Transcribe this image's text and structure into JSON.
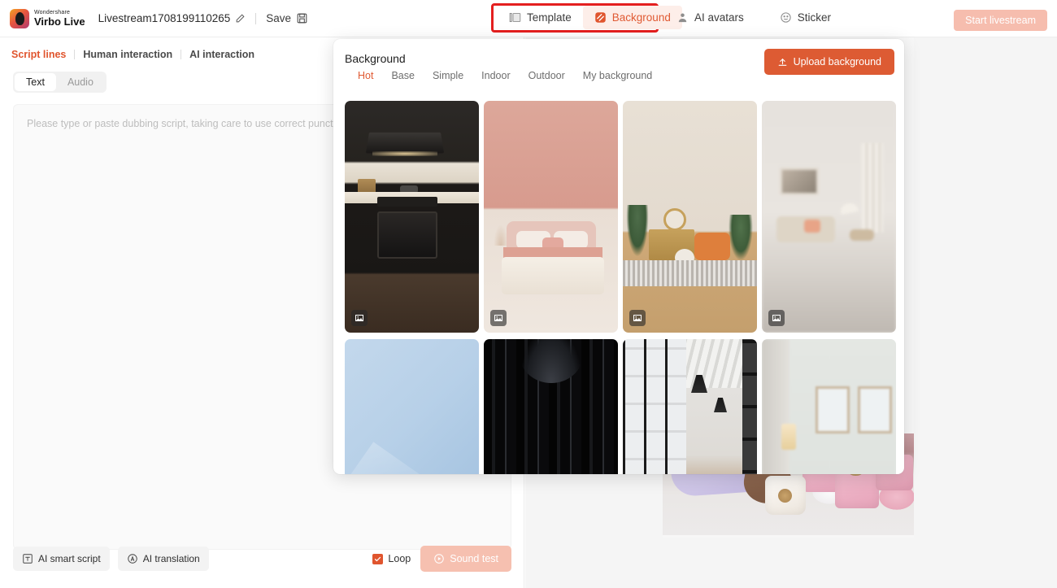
{
  "topbar": {
    "brand_small": "Wondershare",
    "brand_name": "Virbo Live",
    "project_title": "Livestream1708199110265",
    "save_label": "Save",
    "tabs": [
      {
        "label": "Template",
        "icon": "template-icon",
        "active": false
      },
      {
        "label": "Background",
        "icon": "background-icon",
        "active": true
      },
      {
        "label": "AI avatars",
        "icon": "avatar-icon",
        "active": false
      },
      {
        "label": "Sticker",
        "icon": "sticker-icon",
        "active": false
      }
    ],
    "start_button": "Start livestream",
    "highlight_color": "#e41f1f",
    "accent_color": "#e0552e"
  },
  "left": {
    "script_tabs": [
      {
        "label": "Script lines",
        "active": true
      },
      {
        "label": "Human interaction",
        "active": false
      },
      {
        "label": "AI interaction",
        "active": false
      }
    ],
    "mode_tabs": [
      {
        "label": "Text",
        "active": true
      },
      {
        "label": "Audio",
        "active": false
      }
    ],
    "script_placeholder": "Please type or paste dubbing script, taking care to use correct punctuation.",
    "script_value": "",
    "footer": {
      "ai_smart_script": "AI smart script",
      "ai_translation": "AI translation",
      "loop_label": "Loop",
      "loop_checked": true,
      "sound_test": "Sound test"
    }
  },
  "background_panel": {
    "title": "Background",
    "upload_button": "Upload background",
    "upload_color": "#dd5b33",
    "categories": [
      {
        "label": "Hot",
        "active": true
      },
      {
        "label": "Base",
        "active": false
      },
      {
        "label": "Simple",
        "active": false
      },
      {
        "label": "Indoor",
        "active": false
      },
      {
        "label": "Outdoor",
        "active": false
      },
      {
        "label": "My background",
        "active": false
      }
    ],
    "items": [
      {
        "name": "dark-modern-kitchen",
        "badge": "image-icon"
      },
      {
        "name": "pink-bedroom",
        "badge": "image-icon"
      },
      {
        "name": "living-room-plants-orange-chair",
        "badge": "image-icon"
      },
      {
        "name": "blurred-beige-living-room",
        "badge": "image-icon"
      },
      {
        "name": "blue-abstract-geometric",
        "badge": "image-icon"
      },
      {
        "name": "black-vertical-stripes",
        "badge": "image-icon"
      },
      {
        "name": "industrial-loft-pendant-lights",
        "badge": "image-icon"
      },
      {
        "name": "room-with-framed-art",
        "badge": "image-icon"
      }
    ]
  },
  "preview": {
    "scene_name": "person-with-tissue-rolls"
  }
}
